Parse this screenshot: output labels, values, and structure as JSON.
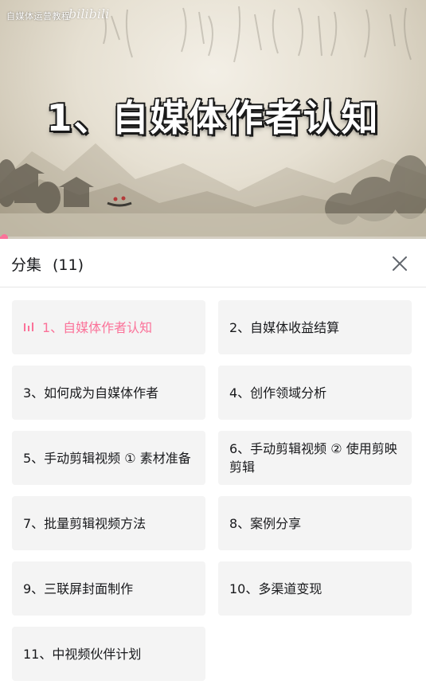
{
  "video": {
    "channel_text": "自媒体运营教程",
    "logo_text": "bilibili",
    "title_text": "1、自媒体作者认知",
    "progress_fraction": 0.01,
    "accent_color": "#fb7299"
  },
  "panel": {
    "title": "分集",
    "count": "(11)",
    "close_icon": "close-icon"
  },
  "episodes": [
    {
      "label": "1、自媒体作者认知",
      "active": true
    },
    {
      "label": "2、自媒体收益结算",
      "active": false
    },
    {
      "label": "3、如何成为自媒体作者",
      "active": false
    },
    {
      "label": "4、创作领域分析",
      "active": false
    },
    {
      "label": "5、手动剪辑视频 ① 素材准备",
      "active": false
    },
    {
      "label": "6、手动剪辑视频 ② 使用剪映剪辑",
      "active": false
    },
    {
      "label": "7、批量剪辑视频方法",
      "active": false
    },
    {
      "label": "8、案例分享",
      "active": false
    },
    {
      "label": "9、三联屏封面制作",
      "active": false
    },
    {
      "label": "10、多渠道变现",
      "active": false
    },
    {
      "label": "11、中视频伙伴计划",
      "active": false
    }
  ]
}
